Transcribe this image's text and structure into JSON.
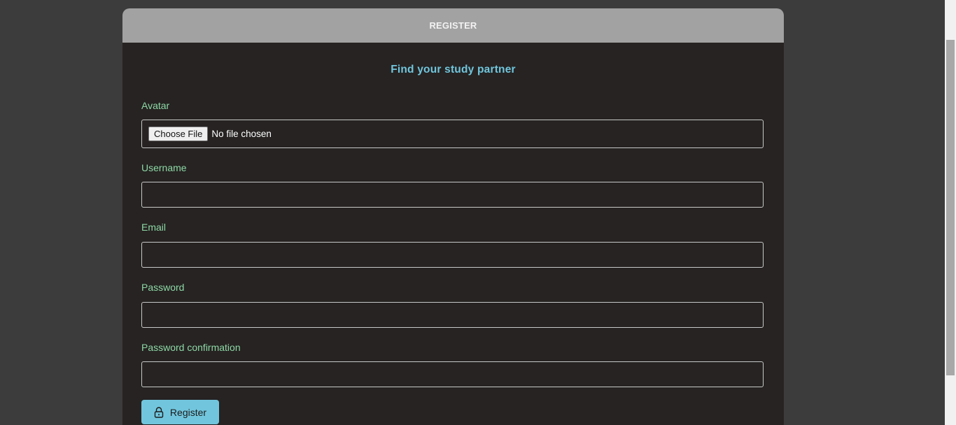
{
  "header": {
    "title": "REGISTER"
  },
  "subtitle": "Find your study partner",
  "form": {
    "avatar": {
      "label": "Avatar",
      "button_label": "Choose File",
      "status": "No file chosen"
    },
    "username": {
      "label": "Username",
      "value": ""
    },
    "email": {
      "label": "Email",
      "value": ""
    },
    "password": {
      "label": "Password",
      "value": ""
    },
    "password_confirmation": {
      "label": "Password confirmation",
      "value": ""
    },
    "submit": {
      "label": "Register",
      "icon": "lock-icon"
    }
  },
  "colors": {
    "page_background": "#3c3c3c",
    "card_background": "#262322",
    "header_background": "#a3a2a2",
    "accent": "#71c6dd",
    "label": "#8ed8a6"
  }
}
